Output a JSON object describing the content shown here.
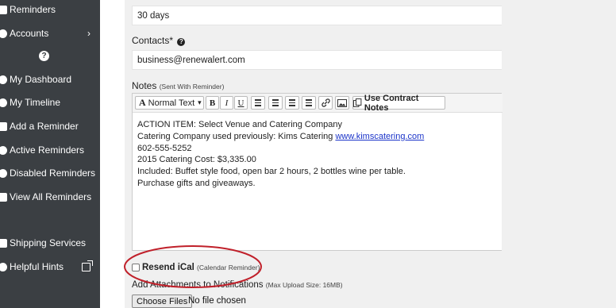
{
  "sidebar": {
    "items": [
      {
        "label": "Reminders",
        "icon": "reminders-icon"
      },
      {
        "label": "Accounts",
        "icon": "accounts-icon",
        "chevron": "›"
      },
      {
        "label": "My Dashboard",
        "icon": "dashboard-icon"
      },
      {
        "label": "My Timeline",
        "icon": "timeline-icon"
      },
      {
        "label": "Add a Reminder",
        "icon": "add-reminder-icon"
      },
      {
        "label": "Active Reminders",
        "icon": "active-reminders-icon"
      },
      {
        "label": "Disabled Reminders",
        "icon": "disabled-reminders-icon"
      },
      {
        "label": "View All Reminders",
        "icon": "view-all-icon"
      },
      {
        "label": "Shipping Services",
        "icon": "shipping-icon"
      },
      {
        "label": "Helpful Hints",
        "icon": "hints-icon"
      }
    ],
    "help_glyph": "?"
  },
  "form": {
    "period_value": "30 days",
    "contacts_label": "Contacts*",
    "contacts_help_glyph": "?",
    "contacts_value": "business@renewalert.com",
    "notes_label": "Notes",
    "notes_sub": "(Sent With Reminder)",
    "toolbar": {
      "format_label": "Normal Text",
      "format_caret": "▾",
      "bold": "B",
      "italic": "I",
      "underline": "U",
      "contract_notes_label": "Use Contract Notes"
    },
    "notes_lines": [
      "ACTION ITEM:  Select Venue and Catering Company",
      "Catering Company used previously:  Kims Catering ",
      "602-555-5252",
      "2015 Catering Cost:  $3,335.00",
      "Included:  Buffet style food, open bar 2 hours, 2 bottles wine per table.",
      "Purchase gifts and giveaways."
    ],
    "notes_link": "www.kimscatering.com",
    "resend_label": "Resend iCal",
    "resend_sub": "(Calendar Reminder)",
    "resend_checked": false,
    "attach_label": "Add Attachments to Notifications",
    "attach_sub": "(Max Upload Size: 16MB)",
    "file_button": "Choose Files",
    "file_status": "No file chosen"
  },
  "colors": {
    "sidebar_bg": "#3b3f43",
    "panel_bg": "#f0f0f0",
    "annotation": "#c0202a",
    "link": "#1a33c9"
  }
}
